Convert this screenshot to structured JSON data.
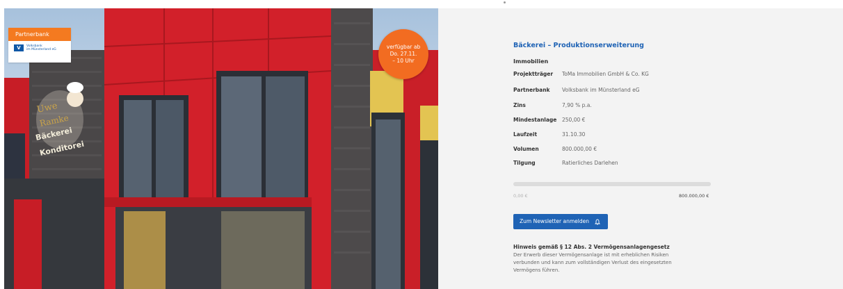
{
  "badge": {
    "header": "Partnerbank",
    "logo_text_line1": "Volksbank",
    "logo_text_line2": "im Münsterland eG"
  },
  "availability": {
    "line1": "verfügbar ab",
    "line2": "Do. 27.11.",
    "line3": "– 10 Uhr"
  },
  "project": {
    "title": "Bäckerei – Produktionserweiterung",
    "category": "Immobilien",
    "rows": [
      {
        "label": "Projektträger",
        "value": "ToMa Immobilien GmbH & Co. KG"
      },
      {
        "label": "Partnerbank",
        "value": "Volksbank im Münsterland eG"
      },
      {
        "label": "Zins",
        "value": "7,90 % p.a."
      },
      {
        "label": "Mindestanlage",
        "value": "250,00 €"
      },
      {
        "label": "Laufzeit",
        "value": "31.10.30"
      },
      {
        "label": "Volumen",
        "value": "800.000,00 €"
      },
      {
        "label": "Tilgung",
        "value": "Ratierliches Darlehen"
      }
    ]
  },
  "progress": {
    "fraction": 0.0,
    "min_label": "0,00 €",
    "max_label": "800.000,00 €"
  },
  "newsletter_button": {
    "label": "Zum Newsletter anmelden",
    "icon": "bell-icon"
  },
  "hint": {
    "title": "Hinweis gemäß § 12 Abs. 2 Vermögensanlagengesetz",
    "text": "Der Erwerb dieser Vermögensanlage ist mit erheblichen Risiken verbunden und kann zum vollständigen Verlust des eingesetzten Vermögens führen."
  },
  "colors": {
    "accent": "#1f63b5",
    "orange": "#f26c21",
    "panel_bg": "#f3f3f3",
    "facade_red": "#d2202a"
  }
}
